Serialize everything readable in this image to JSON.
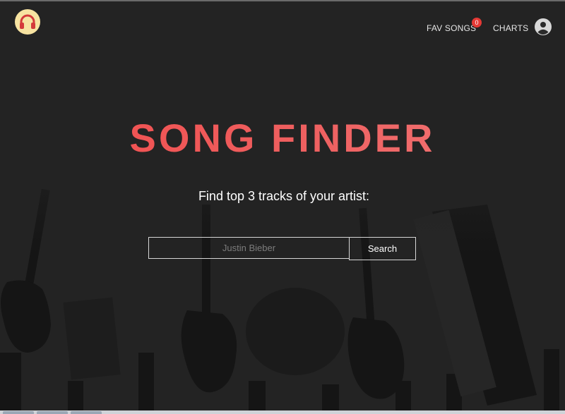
{
  "header": {
    "logo_icon": "headphones-icon",
    "nav": {
      "fav_songs_label": "FAV SONGS",
      "fav_count": "0",
      "charts_label": "CHARTS",
      "user_icon": "user-account-icon"
    }
  },
  "hero": {
    "title": "SONG FINDER",
    "subtitle": "Find top 3 tracks of your artist:",
    "search": {
      "placeholder": "Justin Bieber",
      "value": "",
      "button_label": "Search"
    }
  },
  "colors": {
    "background": "#232323",
    "title_gradient_start": "#f24b4b",
    "title_gradient_end": "#f27a7a",
    "badge": "#e53935",
    "logo_bg": "#f7e3a1"
  }
}
